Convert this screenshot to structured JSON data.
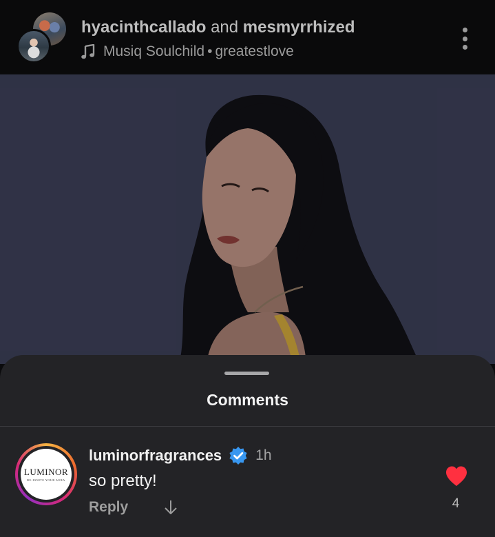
{
  "header": {
    "user_one": "hyacinthcallado",
    "conjunction": "and",
    "user_two": "mesmyrrhized",
    "music_icon": "music-note-icon",
    "artist": "Musiq Soulchild",
    "separator": "•",
    "song": "greatestlove",
    "menu_icon": "more-vertical-icon"
  },
  "photo": {
    "background_color": "#3a3d55",
    "hair_color": "#111015",
    "skin_color": "#b88e80",
    "strap_color": "#c9a13a"
  },
  "comments_sheet": {
    "title": "Comments",
    "comments": [
      {
        "avatar_brand": "LUMINOR",
        "avatar_tagline": "RE-IGNITE YOUR AURA",
        "username": "luminorfragrances",
        "verified": true,
        "time": "1h",
        "text": "so pretty!",
        "reply_label": "Reply",
        "liked": true,
        "like_count": "4"
      }
    ]
  },
  "colors": {
    "verified_blue": "#3897f0",
    "like_red": "#ff3040",
    "sheet_bg": "#232326"
  }
}
